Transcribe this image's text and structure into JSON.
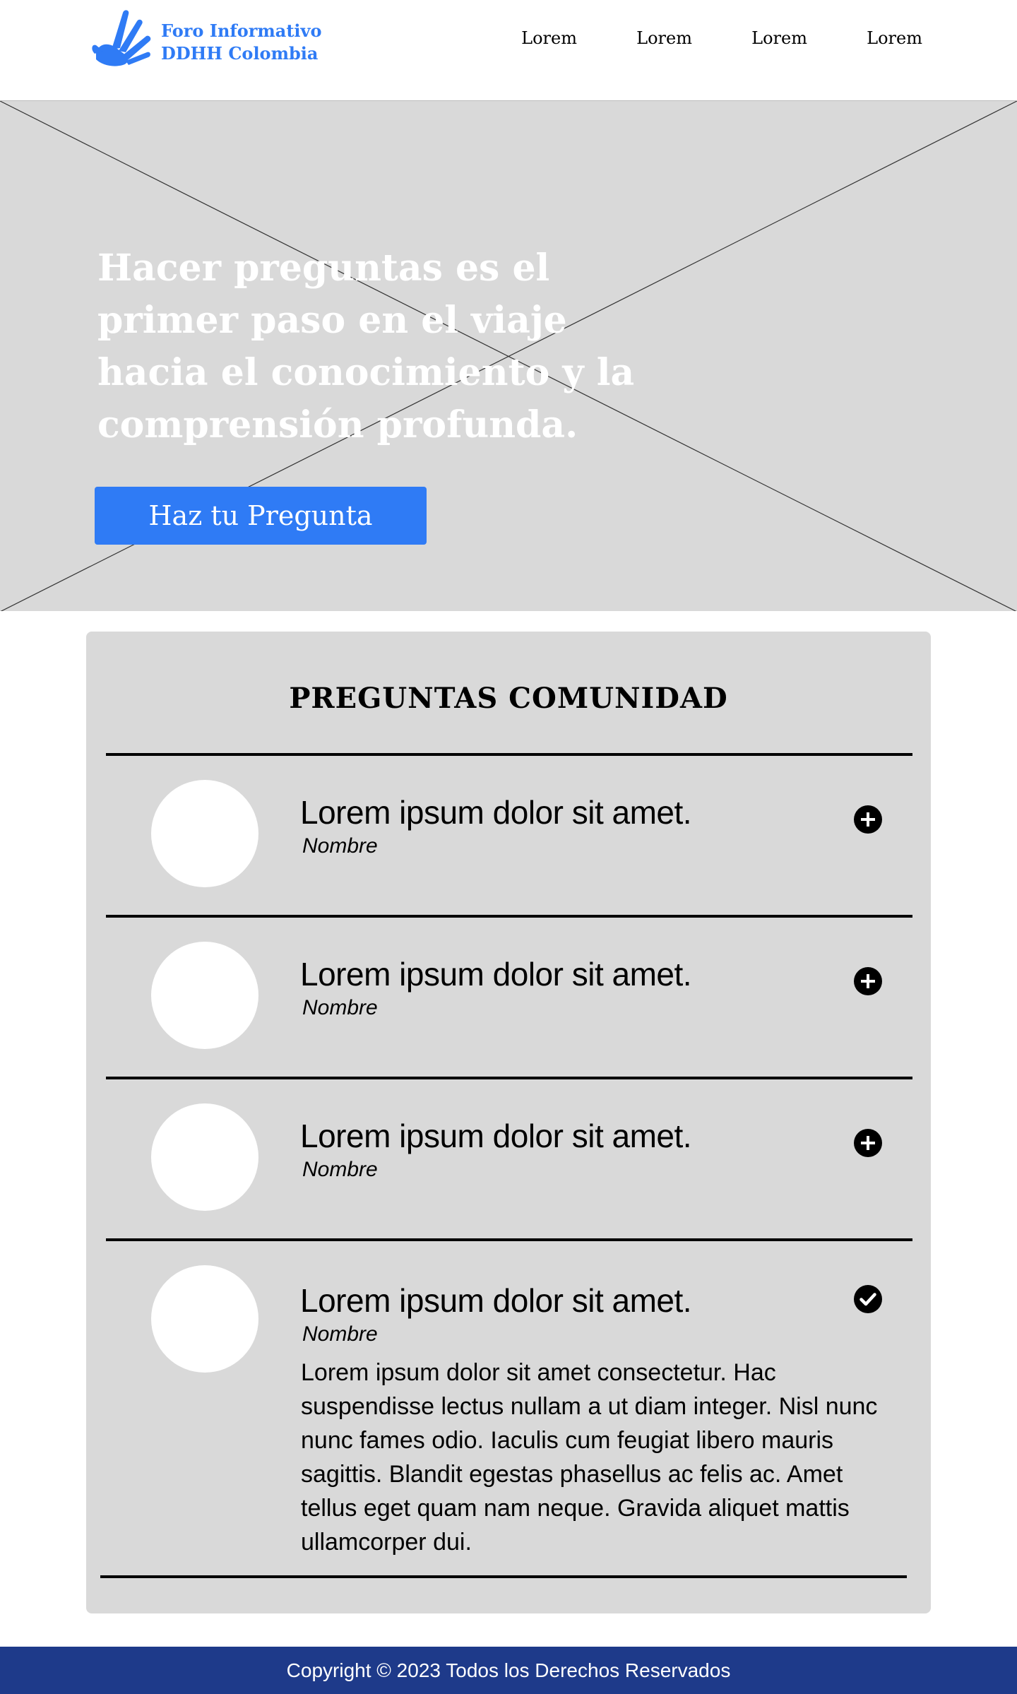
{
  "header": {
    "logo_line1": "Foro Informativo",
    "logo_line2": "DDHH Colombia",
    "logo_icon": "hand-icon",
    "nav": [
      "Lorem",
      "Lorem",
      "Lorem",
      "Lorem"
    ]
  },
  "hero": {
    "title": "Hacer preguntas es el primer paso en el viaje hacia el conocimiento y la comprensión profunda.",
    "button_label": "Haz tu Pregunta",
    "image_placeholder": "image-placeholder"
  },
  "questions": {
    "heading": "PREGUNTAS COMUNIDAD",
    "items": [
      {
        "title": "Lorem ipsum dolor sit amet.",
        "author": "Nombre",
        "icon": "plus-circle-icon",
        "expanded": false
      },
      {
        "title": "Lorem ipsum dolor sit amet.",
        "author": "Nombre",
        "icon": "plus-circle-icon",
        "expanded": false
      },
      {
        "title": "Lorem ipsum dolor sit amet.",
        "author": "Nombre",
        "icon": "plus-circle-icon",
        "expanded": false
      },
      {
        "title": "Lorem ipsum dolor sit amet.",
        "author": "Nombre",
        "icon": "check-circle-icon",
        "expanded": true,
        "body": "Lorem ipsum dolor sit amet consectetur. Hac suspendisse lectus nullam a ut diam integer. Nisl nunc nunc fames odio. Iaculis cum feugiat libero mauris sagittis. Blandit egestas phasellus ac felis ac. Amet tellus eget quam nam neque. Gravida aliquet mattis ullamcorper dui."
      }
    ]
  },
  "footer": {
    "copyright": "Copyright © 2023 Todos los Derechos Reservados"
  },
  "colors": {
    "brand_blue": "#2F7BF5",
    "footer_navy": "#1E3A8A",
    "placeholder_gray": "#D9D9D9"
  }
}
